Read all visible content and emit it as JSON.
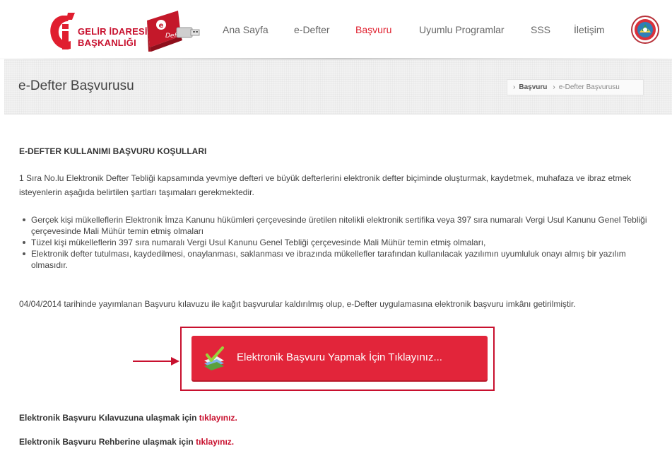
{
  "header": {
    "logo_line1": "GELİR İDARESİ",
    "logo_line2": "BAŞKANLIĞI",
    "book_label": "Defter",
    "nav": [
      {
        "label": "Ana Sayfa",
        "active": false
      },
      {
        "label": "e-Defter",
        "active": false
      },
      {
        "label": "Başvuru",
        "active": true
      },
      {
        "label": "Uyumlu Programlar",
        "active": false
      },
      {
        "label": "SSS",
        "active": false
      },
      {
        "label": "İletişim",
        "active": false
      }
    ]
  },
  "band": {
    "title": "e-Defter Başvurusu",
    "breadcrumb": [
      "Başvuru",
      "e-Defter Başvurusu"
    ]
  },
  "content": {
    "heading": "E-DEFTER KULLANIMI BAŞVURU KOŞULLARI",
    "intro": "1 Sıra No.lu Elektronik Defter Tebliği kapsamında yevmiye defteri ve büyük defterlerini elektronik defter biçiminde oluşturmak, kaydetmek, muhafaza ve ibraz etmek isteyenlerin aşağıda belirtilen şartları taşımaları gerekmektedir.",
    "bullets": [
      "Gerçek kişi mükelleflerin Elektronik İmza Kanunu hükümleri çerçevesinde üretilen nitelikli elektronik sertifika veya 397 sıra numaralı Vergi Usul Kanunu Genel Tebliği çerçevesinde Mali Mühür temin etmiş olmaları",
      "Tüzel kişi mükelleflerin 397 sıra numaralı Vergi Usul Kanunu Genel Tebliği çerçevesinde Mali Mühür temin etmiş olmaları,",
      "Elektronik defter tutulması, kaydedilmesi, onaylanması, saklanması ve ibrazında mükellefler tarafından kullanılacak yazılımın uyumluluk onayı almış bir yazılım olmasıdır."
    ],
    "notice": "04/04/2014 tarihinde yayımlanan Başvuru kılavuzu ile kağıt başvurular kaldırılmış olup, e-Defter uygulamasına elektronik başvuru imkânı getirilmiştir.",
    "apply_button": "Elektronik Başvuru Yapmak İçin Tıklayınız...",
    "guide_text": "Elektronik Başvuru Kılavuzuna ulaşmak için",
    "guide_link": "tıklayınız.",
    "handbook_text": "Elektronik Başvuru Rehberine ulaşmak için",
    "handbook_link": "tıklayınız."
  },
  "colors": {
    "brand_red": "#e2253a",
    "nav_active": "#e0202f",
    "highlight": "#c8102e"
  }
}
